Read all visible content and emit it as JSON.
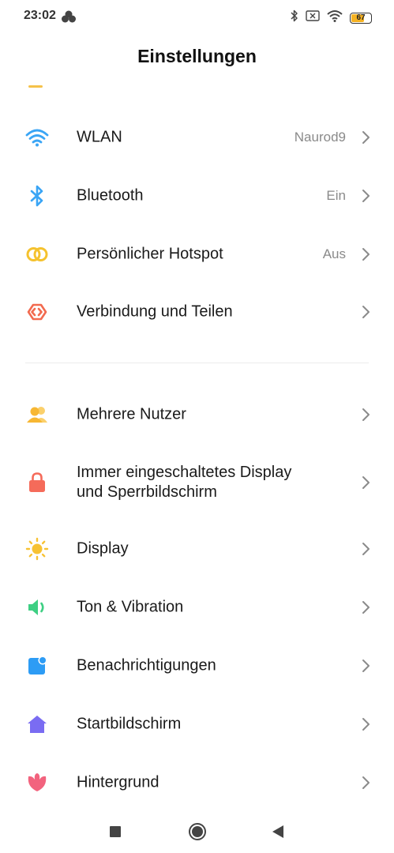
{
  "status_bar": {
    "time": "23:02",
    "battery_level": "67",
    "battery_fraction": 0.67,
    "battery_color": "#f5b223",
    "left_icons": [
      "cloud-icon"
    ],
    "right_icons": [
      "bluetooth-icon",
      "no-sim-icon",
      "wifi-icon",
      "battery-icon"
    ]
  },
  "header": {
    "title": "Einstellungen"
  },
  "settings": {
    "network": [
      {
        "label": "WLAN",
        "value": "Naurod9",
        "icon": "wifi-icon",
        "color": "#3aa5f5"
      },
      {
        "label": "Bluetooth",
        "value": "Ein",
        "icon": "bluetooth-icon",
        "color": "#3aa5f5"
      },
      {
        "label": "Persönlicher Hotspot",
        "value": "Aus",
        "icon": "hotspot-icon",
        "color": "#f5c22e"
      },
      {
        "label": "Verbindung und Teilen",
        "value": "",
        "icon": "connection-share-icon",
        "color": "#f26a4f"
      }
    ],
    "system": [
      {
        "label": "Mehrere Nutzer",
        "icon": "users-icon",
        "color": "#f7b733"
      },
      {
        "label_line1": "Immer eingeschaltetes Display",
        "label_line2": "und Sperrbildschirm",
        "icon": "lock-icon",
        "color": "#f56b5a"
      },
      {
        "label": "Display",
        "icon": "sun-icon",
        "color": "#f7c233"
      },
      {
        "label": "Ton & Vibration",
        "icon": "speaker-icon",
        "color": "#3ecf83"
      },
      {
        "label": "Benachrichtigungen",
        "icon": "notification-icon",
        "color": "#2d9cf5"
      },
      {
        "label": "Startbildschirm",
        "icon": "home-icon",
        "color": "#7a6cf2"
      },
      {
        "label": "Hintergrund",
        "icon": "tulip-icon",
        "color": "#f2637e"
      }
    ]
  },
  "nav_bar": {
    "buttons": [
      "recents-button",
      "home-button",
      "back-button"
    ]
  }
}
